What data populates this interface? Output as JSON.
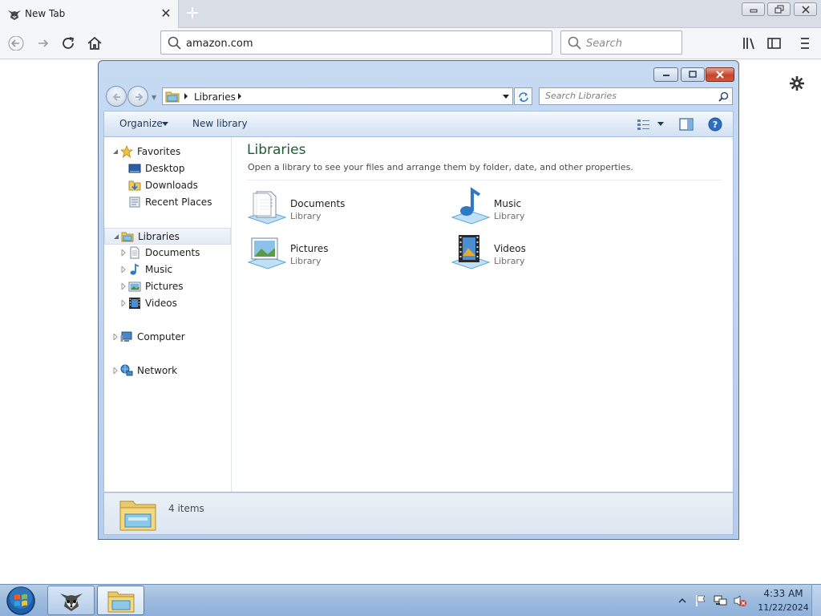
{
  "browser": {
    "tab_title": "New Tab",
    "url": "amazon.com",
    "search_placeholder": "Search"
  },
  "explorer": {
    "address": {
      "segment": "Libraries"
    },
    "search_placeholder": "Search Libraries",
    "commands": {
      "organize": "Organize",
      "new_library": "New library"
    },
    "nav": {
      "favorites": "Favorites",
      "desktop": "Desktop",
      "downloads": "Downloads",
      "recent_places": "Recent Places",
      "libraries": "Libraries",
      "documents": "Documents",
      "music": "Music",
      "pictures": "Pictures",
      "videos": "Videos",
      "computer": "Computer",
      "network": "Network"
    },
    "content": {
      "title": "Libraries",
      "subtitle": "Open a library to see your files and arrange them by folder, date, and other properties.",
      "items": [
        {
          "name": "Documents",
          "type": "Library",
          "icon": "documents-library-icon"
        },
        {
          "name": "Music",
          "type": "Library",
          "icon": "music-library-icon"
        },
        {
          "name": "Pictures",
          "type": "Library",
          "icon": "pictures-library-icon"
        },
        {
          "name": "Videos",
          "type": "Library",
          "icon": "videos-library-icon"
        }
      ]
    },
    "details": {
      "count": "4 items"
    }
  },
  "taskbar": {
    "time": "4:33 AM",
    "date": "11/22/2024"
  },
  "colors": {
    "content_title": "#1e5b36",
    "taskbar": "#9fbcde",
    "window_frame": "#b5cdec"
  }
}
